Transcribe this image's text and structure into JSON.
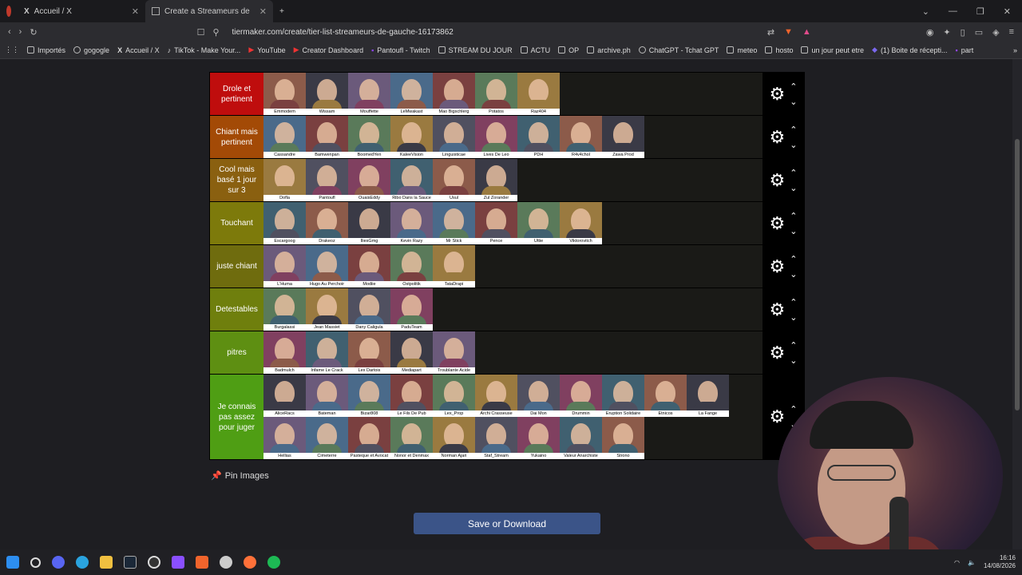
{
  "browser": {
    "tabs": [
      {
        "label": "Accueil / X"
      },
      {
        "label": "Create a Streameurs de Gauche"
      }
    ],
    "url": "tiermaker.com/create/tier-list-streameurs-de-gauche-16173862",
    "bookmarks": [
      "Importés",
      "gogogle",
      "Accueil / X",
      "TikTok - Make Your...",
      "YouTube",
      "Creator Dashboard",
      "Pantoufl - Twitch",
      "STREAM DU JOUR",
      "ACTU",
      "OP",
      "archive.ph",
      "ChatGPT - Tchat GPT",
      "meteo",
      "hosto",
      "un jour peut etre",
      "(1) Boite de récepti...",
      "part"
    ]
  },
  "tiers": [
    {
      "label": "Drole et pertinent",
      "color": "#bf0d0d",
      "items": [
        "Emmodem",
        "Wissam",
        "Mouffette",
        "LeMwakast",
        "Mao Bigschlerg",
        "Potatos",
        "Raz404"
      ]
    },
    {
      "label": "Chiant mais pertinent",
      "color": "#a34a06",
      "items": [
        "Cassandre",
        "Bamwenpan",
        "BoomedYen",
        "KaleeVision",
        "Linguisticae",
        "Lives De Leo",
        "PDH",
        "R4v4chol",
        "Zawa Prod"
      ]
    },
    {
      "label": "Cool mais basé 1 jour sur 3",
      "color": "#8a6010",
      "items": [
        "Dofla",
        "Pantoufl",
        "OuaisEddy",
        "Ribo Dans la Sauce",
        "Usul",
        "Zul Zorander"
      ]
    },
    {
      "label": "Touchant",
      "color": "#7d7a0b",
      "items": [
        "Escargoog",
        "Drakeoz",
        "IliesGmg",
        "Kevin Razy",
        "Mr Stick",
        "Pence",
        "Uttie",
        "Viktorovitch"
      ]
    },
    {
      "label": "juste chiant",
      "color": "#6f6c0e",
      "items": [
        "L'Huma",
        "Hugo Au Perchoir",
        "Modiie",
        "Ostpolitik",
        "TataDrapi"
      ]
    },
    {
      "label": "Detestables",
      "color": "#6f7f0d",
      "items": [
        "Burgalassi",
        "Jean Massiet",
        "Dany Caligula",
        "PaduTeam"
      ]
    },
    {
      "label": "pitres",
      "color": "#5e8f12",
      "items": [
        "Badmulch",
        "Infame Le Crack",
        "Lex Dartois",
        "Mediapart",
        "Troublante Acide"
      ]
    },
    {
      "label": "Je connais pas assez pour juger",
      "color": "#4f9e14",
      "items": [
        "AliceRacs",
        "Bateman",
        "Bizar808",
        "Le Fils De Pub",
        "Lex_Prop",
        "Archi Crasseuse",
        "Dai Mon",
        "Drummin",
        "Eruption Solidaire",
        "Etnicos",
        "La Fange",
        "Hellias",
        "Cimeterre",
        "Pasteque et Avocat",
        "Nonor et Denmax",
        "Norman Ajari",
        "Staf_Stream",
        "Yukaino",
        "Valeur Anarchiste",
        "Strono"
      ]
    }
  ],
  "pin_label": "Pin Images",
  "save_label": "Save or Download",
  "clock": {
    "time": "16:16",
    "date": "14/08/2026"
  },
  "icons": {
    "settings": "gear-icon",
    "up": "chevron-up-icon",
    "down": "chevron-down-icon"
  }
}
